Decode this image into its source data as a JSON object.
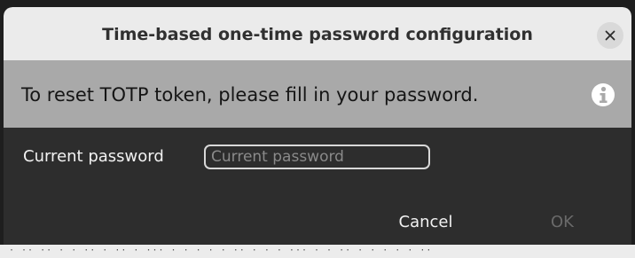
{
  "dialog": {
    "title": "Time-based one-time password configuration",
    "close_icon": "close-icon"
  },
  "infobar": {
    "message": "To reset TOTP token, please fill in your password.",
    "icon": "info-icon"
  },
  "form": {
    "password_label": "Current password",
    "password_value": "",
    "password_placeholder": "Current password"
  },
  "actions": {
    "cancel_label": "Cancel",
    "ok_label": "OK",
    "ok_enabled": false
  },
  "colors": {
    "titlebar_bg": "#ebebeb",
    "infobar_bg": "#a9a9a9",
    "dialog_bg": "#2d2d2d",
    "disabled_text": "#6a6a6a"
  }
}
